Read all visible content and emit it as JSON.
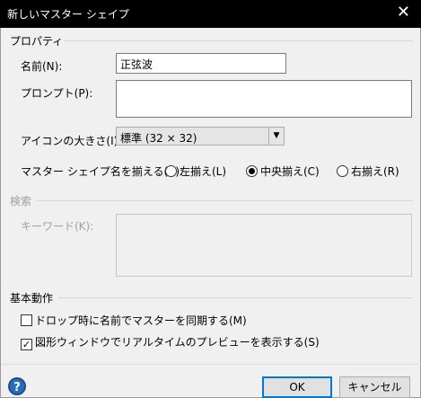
{
  "window": {
    "title": "新しいマスター シェイプ",
    "close_glyph": "✕"
  },
  "properties": {
    "section_title": "プロパティ",
    "name_label": "名前(N):",
    "name_value": "正弦波",
    "prompt_label": "プロンプト(P):",
    "prompt_value": "",
    "icon_size_label": "アイコンの大きさ(I):",
    "icon_size_value": "標準 (32 × 32)",
    "align_label": "マスター シェイプ名を揃える(A):",
    "align_options": [
      {
        "label": "左揃え(L)",
        "checked": false
      },
      {
        "label": "中央揃え(C)",
        "checked": true
      },
      {
        "label": "右揃え(R)",
        "checked": false
      }
    ]
  },
  "search": {
    "section_title": "検索",
    "keyword_label": "キーワード(K):",
    "keyword_value": ""
  },
  "behavior": {
    "section_title": "基本動作",
    "options": [
      {
        "label": "ドロップ時に名前でマスターを同期する(M)",
        "checked": false
      },
      {
        "label": "図形ウィンドウでリアルタイムのプレビューを表示する(S)",
        "checked": true
      }
    ]
  },
  "footer": {
    "help_glyph": "?",
    "ok_label": "OK",
    "cancel_label": "キャンセル"
  }
}
